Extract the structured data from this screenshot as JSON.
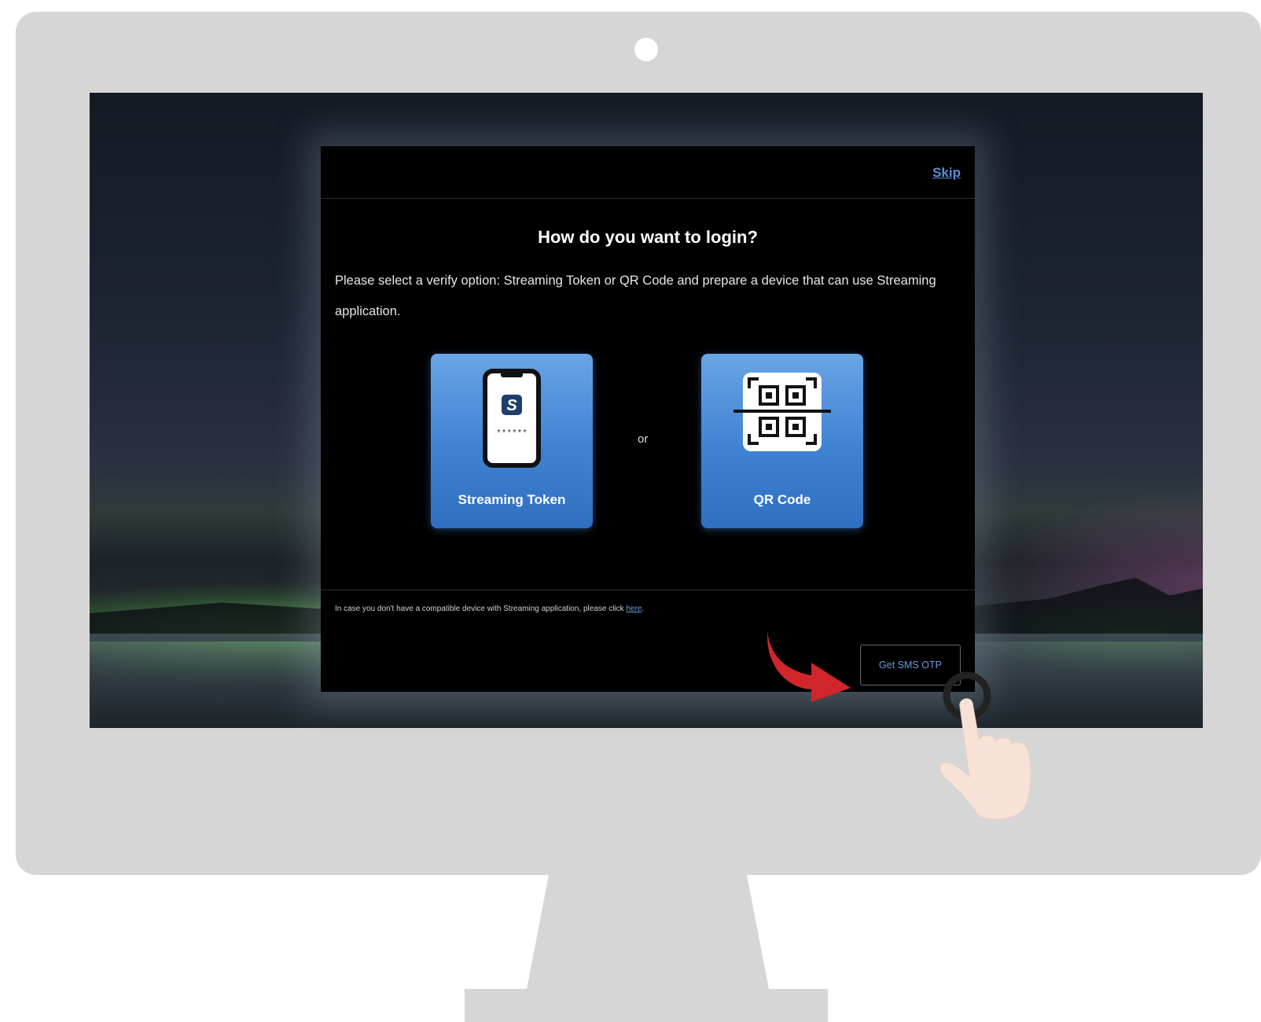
{
  "dialog": {
    "skip_label": "Skip",
    "title": "How do you want to login?",
    "instructions": "Please select a verify option: Streaming Token or QR Code and prepare a device that can use Streaming application.",
    "options": [
      {
        "label": "Streaming Token",
        "icon": "phone-token-icon"
      },
      {
        "label": "QR Code",
        "icon": "qr-scan-icon"
      }
    ],
    "or_label": "or",
    "footer_note_prefix": "In case you don't have a compatible device with Streaming application, please click",
    "footer_link_label": "here",
    "footer_note_suffix": ".",
    "sms_button_label": "Get SMS OTP"
  },
  "token_icon_letter": "S",
  "token_icon_code": "******",
  "colors": {
    "card_blue": "#3f82d2",
    "link_blue": "#6c9be0",
    "arrow_red": "#d0262b",
    "bezel_gray": "#d6d6d6",
    "hand_skin": "#f8e2d6"
  },
  "annotations": {
    "arrow_icon": "red-curved-arrow-icon",
    "cursor_icon": "tap-hand-icon"
  }
}
